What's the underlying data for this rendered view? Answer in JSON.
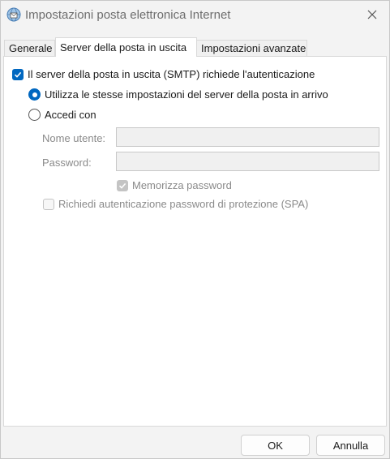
{
  "window": {
    "title": "Impostazioni posta elettronica Internet",
    "app_icon": "outlook-mail-icon",
    "close_icon": "close-icon"
  },
  "tabs": [
    {
      "label": "Generale",
      "active": false
    },
    {
      "label": "Server della posta in uscita",
      "active": true
    },
    {
      "label": "Impostazioni avanzate",
      "active": false
    }
  ],
  "smtp_auth": {
    "label": "Il server della posta in uscita (SMTP) richiede l'autenticazione",
    "checked": true
  },
  "options": {
    "same_settings_label": "Utilizza le stesse impostazioni del server della posta in arrivo",
    "same_settings_selected": true,
    "login_label": "Accedi con",
    "login_selected": false
  },
  "credentials": {
    "username_label": "Nome utente:",
    "username_value": "",
    "password_label": "Password:",
    "password_value": "",
    "remember_label": "Memorizza password",
    "remember_checked": true,
    "spa_label": "Richiedi autenticazione password di protezione (SPA)",
    "spa_checked": false
  },
  "buttons": {
    "ok": "OK",
    "cancel": "Annulla"
  }
}
